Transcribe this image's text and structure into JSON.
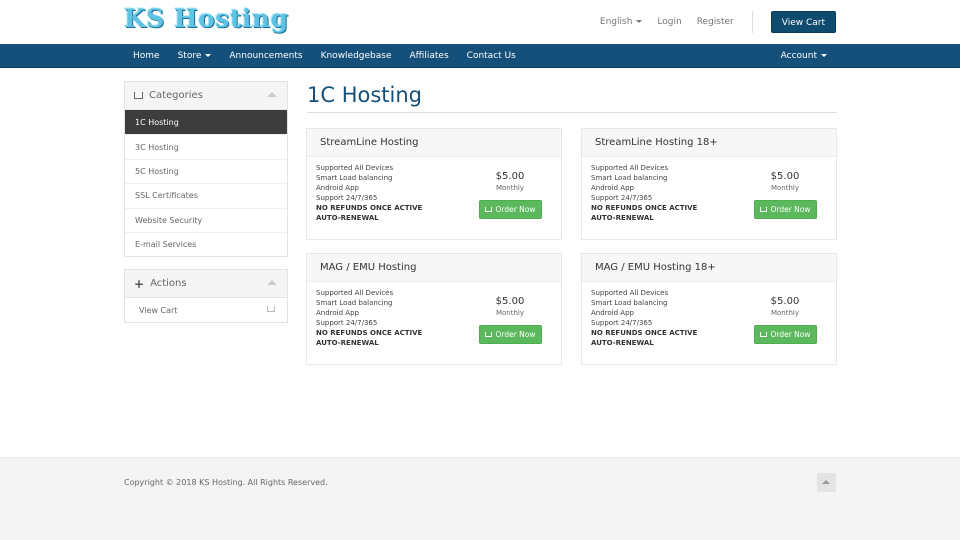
{
  "header": {
    "logo": "KS Hosting",
    "language": "English",
    "login": "Login",
    "register": "Register",
    "view_cart": "View Cart"
  },
  "nav": {
    "items": [
      "Home",
      "Store",
      "Announcements",
      "Knowledgebase",
      "Affiliates",
      "Contact Us"
    ],
    "account": "Account"
  },
  "sidebar": {
    "categories_title": "Categories",
    "categories": [
      "1C Hosting",
      "3C Hosting",
      "5C Hosting",
      "SSL Certificates",
      "Website Security",
      "E-mail Services"
    ],
    "active_category": "1C Hosting",
    "actions_title": "Actions",
    "actions": [
      "View Cart"
    ]
  },
  "main": {
    "title": "1C Hosting",
    "products": [
      {
        "name": "StreamLine Hosting",
        "features": [
          "Supported All Devices",
          "Smart Load balancing",
          "Android App",
          "Support 24/7/365",
          "NO REFUNDS ONCE ACTIVE",
          "AUTO-RENEWAL"
        ],
        "price": "$5.00",
        "cycle": "Monthly",
        "button": "Order Now"
      },
      {
        "name": "StreamLine Hosting 18+",
        "features": [
          "Supported All Devices",
          "Smart Load balancing",
          "Android App",
          "Support 24/7/365",
          "NO REFUNDS ONCE ACTIVE",
          "AUTO-RENEWAL"
        ],
        "price": "$5.00",
        "cycle": "Monthly",
        "button": "Order Now"
      },
      {
        "name": "MAG / EMU Hosting",
        "features": [
          "Supported All Devices",
          "Smart Load balancing",
          "Android App",
          "Support 24/7/365",
          "NO REFUNDS ONCE ACTIVE",
          "AUTO-RENEWAL"
        ],
        "price": "$5.00",
        "cycle": "Monthly",
        "button": "Order Now"
      },
      {
        "name": "MAG / EMU Hosting 18+",
        "features": [
          "Supported All Devices",
          "Smart Load balancing",
          "Android App",
          "Support 24/7/365",
          "NO REFUNDS ONCE ACTIVE",
          "AUTO-RENEWAL"
        ],
        "price": "$5.00",
        "cycle": "Monthly",
        "button": "Order Now"
      }
    ]
  },
  "footer": {
    "copyright": "Copyright © 2018 KS Hosting. All Rights Reserved."
  },
  "colors": {
    "brand_blue": "#14507a",
    "order_green": "#5cb85c",
    "logo_blue": "#5fc3e4"
  }
}
